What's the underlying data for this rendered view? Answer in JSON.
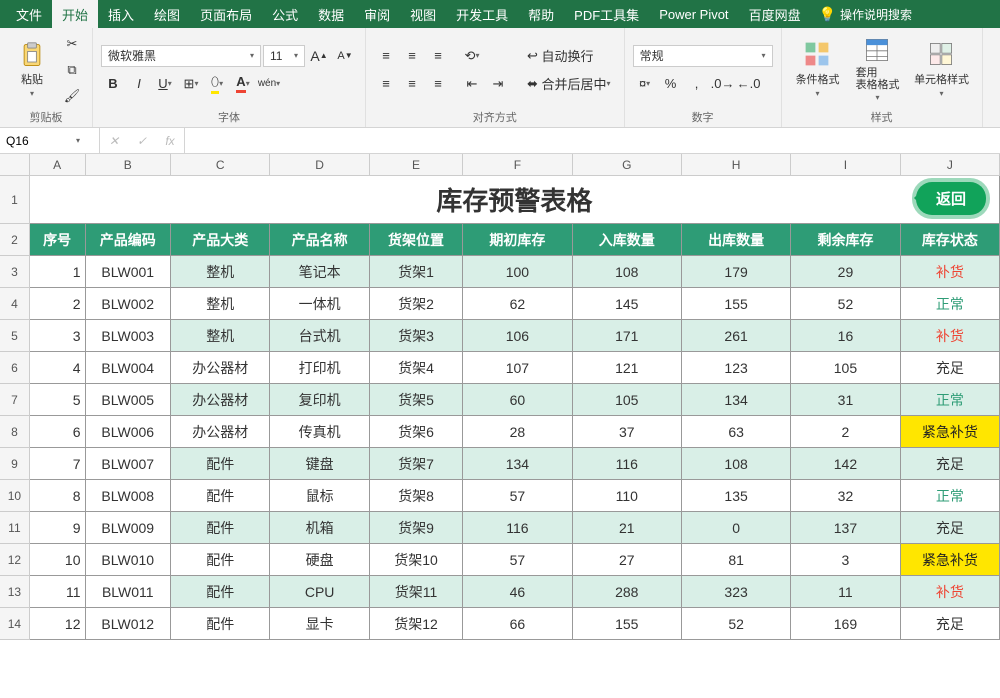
{
  "ribbon": {
    "tabs": [
      "文件",
      "开始",
      "插入",
      "绘图",
      "页面布局",
      "公式",
      "数据",
      "审阅",
      "视图",
      "开发工具",
      "帮助",
      "PDF工具集",
      "Power Pivot",
      "百度网盘"
    ],
    "active": 1,
    "search_placeholder": "操作说明搜索",
    "clipboard": {
      "label": "剪贴板",
      "paste": "粘贴"
    },
    "font": {
      "label": "字体",
      "name": "微软雅黑",
      "size": "11"
    },
    "align": {
      "label": "对齐方式",
      "wrap": "自动换行",
      "merge": "合并后居中"
    },
    "number": {
      "label": "数字",
      "format": "常规"
    },
    "styles": {
      "label": "样式",
      "cond": "条件格式",
      "tbl": "套用\n表格格式",
      "cell": "单元格样式"
    }
  },
  "namebox": "Q16",
  "sheet": {
    "title": "库存预警表格",
    "return_btn": "返回",
    "columns": [
      "A",
      "B",
      "C",
      "D",
      "E",
      "F",
      "G",
      "H",
      "I",
      "J"
    ],
    "headers": [
      "序号",
      "产品编码",
      "产品大类",
      "产品名称",
      "货架位置",
      "期初库存",
      "入库数量",
      "出库数量",
      "剩余库存",
      "库存状态"
    ],
    "row_labels": [
      "1",
      "2",
      "3",
      "4",
      "5",
      "6",
      "7",
      "8",
      "9",
      "10",
      "11",
      "12",
      "13",
      "14"
    ],
    "rows": [
      {
        "n": 1,
        "code": "BLW001",
        "cat": "整机",
        "name": "笔记本",
        "loc": "货架1",
        "init": 100,
        "in": 108,
        "out": 179,
        "rem": 29,
        "status": "补货",
        "tint": true
      },
      {
        "n": 2,
        "code": "BLW002",
        "cat": "整机",
        "name": "一体机",
        "loc": "货架2",
        "init": 62,
        "in": 145,
        "out": 155,
        "rem": 52,
        "status": "正常",
        "tint": false
      },
      {
        "n": 3,
        "code": "BLW003",
        "cat": "整机",
        "name": "台式机",
        "loc": "货架3",
        "init": 106,
        "in": 171,
        "out": 261,
        "rem": 16,
        "status": "补货",
        "tint": true
      },
      {
        "n": 4,
        "code": "BLW004",
        "cat": "办公器材",
        "name": "打印机",
        "loc": "货架4",
        "init": 107,
        "in": 121,
        "out": 123,
        "rem": 105,
        "status": "充足",
        "tint": false
      },
      {
        "n": 5,
        "code": "BLW005",
        "cat": "办公器材",
        "name": "复印机",
        "loc": "货架5",
        "init": 60,
        "in": 105,
        "out": 134,
        "rem": 31,
        "status": "正常",
        "tint": true
      },
      {
        "n": 6,
        "code": "BLW006",
        "cat": "办公器材",
        "name": "传真机",
        "loc": "货架6",
        "init": 28,
        "in": 37,
        "out": 63,
        "rem": 2,
        "status": "紧急补货",
        "tint": false
      },
      {
        "n": 7,
        "code": "BLW007",
        "cat": "配件",
        "name": "键盘",
        "loc": "货架7",
        "init": 134,
        "in": 116,
        "out": 108,
        "rem": 142,
        "status": "充足",
        "tint": true
      },
      {
        "n": 8,
        "code": "BLW008",
        "cat": "配件",
        "name": "鼠标",
        "loc": "货架8",
        "init": 57,
        "in": 110,
        "out": 135,
        "rem": 32,
        "status": "正常",
        "tint": false
      },
      {
        "n": 9,
        "code": "BLW009",
        "cat": "配件",
        "name": "机箱",
        "loc": "货架9",
        "init": 116,
        "in": 21,
        "out": 0,
        "rem": 137,
        "status": "充足",
        "tint": true
      },
      {
        "n": 10,
        "code": "BLW010",
        "cat": "配件",
        "name": "硬盘",
        "loc": "货架10",
        "init": 57,
        "in": 27,
        "out": 81,
        "rem": 3,
        "status": "紧急补货",
        "tint": false
      },
      {
        "n": 11,
        "code": "BLW011",
        "cat": "配件",
        "name": "CPU",
        "loc": "货架11",
        "init": 46,
        "in": 288,
        "out": 323,
        "rem": 11,
        "status": "补货",
        "tint": true
      },
      {
        "n": 12,
        "code": "BLW012",
        "cat": "配件",
        "name": "显卡",
        "loc": "货架12",
        "init": 66,
        "in": 155,
        "out": 52,
        "rem": 169,
        "status": "充足",
        "tint": false
      }
    ]
  }
}
